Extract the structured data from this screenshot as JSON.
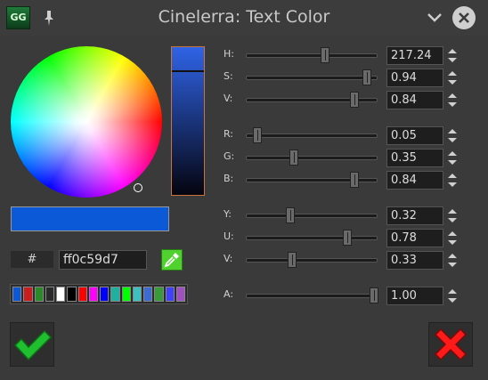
{
  "window": {
    "title": "Cinelerra: Text Color",
    "app_icon_text": "GG"
  },
  "colors": {
    "current": "#0c59d7",
    "accent_value_bar_border": "#c7733a",
    "eyedropper": "#4fd12e",
    "ok": "#1fbf2f",
    "cancel": "#ff1a1a"
  },
  "hex": {
    "button_label": "#",
    "value": "ff0c59d7"
  },
  "palette": [
    "#0c59d7",
    "#c81e1e",
    "#2a8a2a",
    "#2a2a2a",
    "#ffffff",
    "#000000",
    "#ff0000",
    "#ff00ff",
    "#0000ff",
    "#1fb0a0",
    "#00ff00",
    "#3fc0c0",
    "#3c6cd0",
    "#3a9a3a",
    "#4040ff",
    "#a050c0"
  ],
  "sliders": [
    {
      "key": "h",
      "label": "H:",
      "value": "217.24",
      "fraction": 0.6
    },
    {
      "key": "s",
      "label": "S:",
      "value": "0.94",
      "fraction": 0.94
    },
    {
      "key": "v1",
      "label": "V:",
      "value": "0.84",
      "fraction": 0.84
    },
    {
      "key": "r",
      "label": "R:",
      "value": "0.05",
      "fraction": 0.05
    },
    {
      "key": "g",
      "label": "G:",
      "value": "0.35",
      "fraction": 0.35
    },
    {
      "key": "b",
      "label": "B:",
      "value": "0.84",
      "fraction": 0.84
    },
    {
      "key": "y",
      "label": "Y:",
      "value": "0.32",
      "fraction": 0.32
    },
    {
      "key": "u",
      "label": "U:",
      "value": "0.78",
      "fraction": 0.78
    },
    {
      "key": "v2",
      "label": "V:",
      "value": "0.33",
      "fraction": 0.33
    },
    {
      "key": "a",
      "label": "A:",
      "value": "1.00",
      "fraction": 1.0
    }
  ]
}
